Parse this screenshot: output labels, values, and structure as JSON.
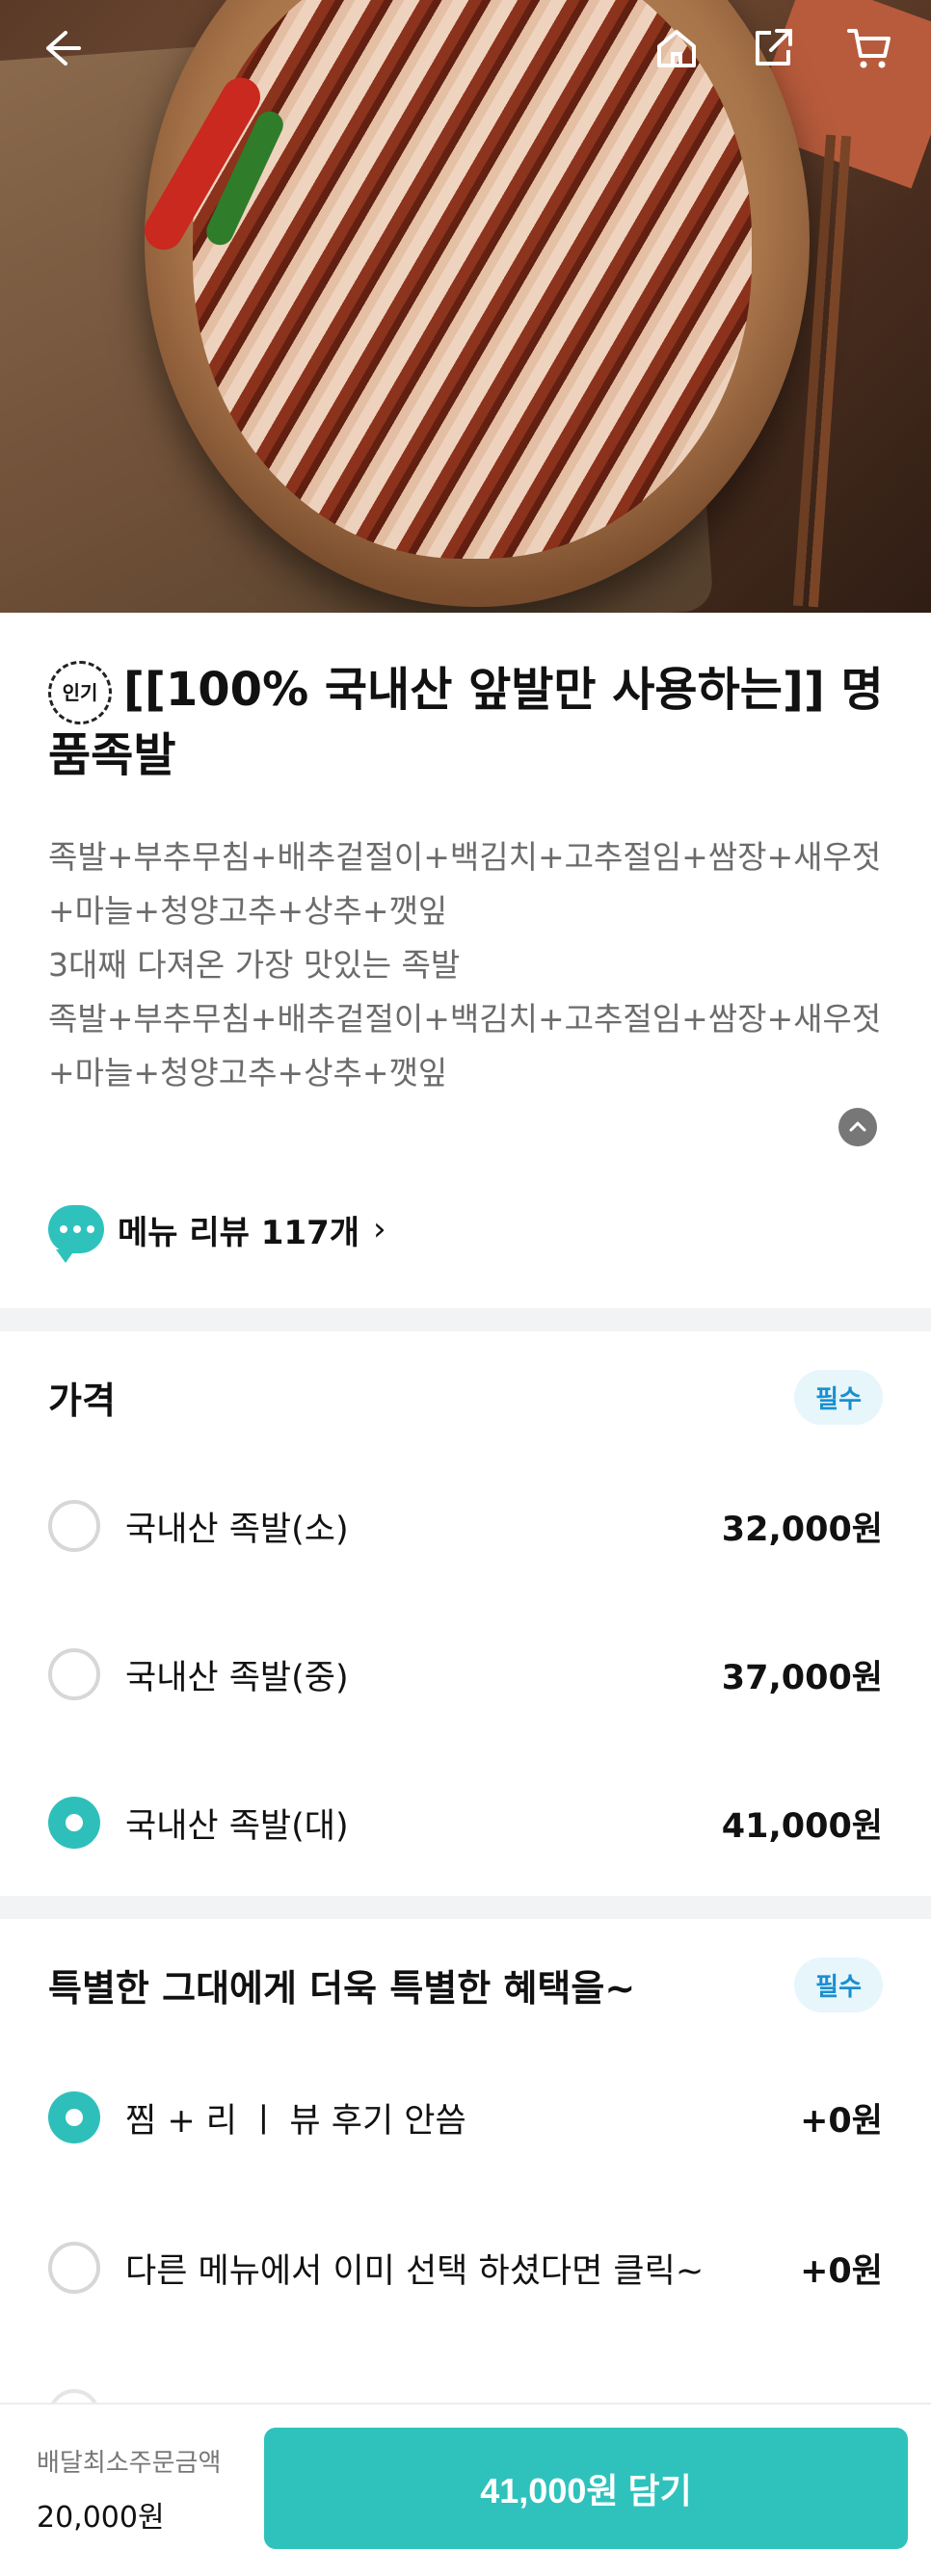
{
  "header": {
    "back_icon": "arrow-left-icon",
    "home_icon": "home-icon",
    "share_icon": "share-icon",
    "cart_icon": "cart-icon"
  },
  "product": {
    "badge": "인기",
    "title": "[[100% 국내산 앞발만 사용하는]] 명품족발",
    "description_lines": [
      "족발+부추무침+배추겉절이+백김치+고추절임+쌈장+새우젓+마늘+청양고추+상추+깻잎",
      "3대째 다져온 가장 맛있는 족발",
      "족발+부추무침+배추겉절이+백김치+고추절임+쌈장+새우젓+마늘+청양고추+상추+깻잎"
    ],
    "review_link": "메뉴 리뷰 117개",
    "review_chevron": "›"
  },
  "price_section": {
    "title": "가격",
    "required": "필수",
    "options": [
      {
        "label": "국내산 족발(소)",
        "price": "32,000원",
        "selected": false
      },
      {
        "label": "국내산 족발(중)",
        "price": "37,000원",
        "selected": false
      },
      {
        "label": "국내산 족발(대)",
        "price": "41,000원",
        "selected": true
      }
    ]
  },
  "benefit_section": {
    "title": "특별한 그대에게 더욱 특별한 혜택을~",
    "required": "필수",
    "options": [
      {
        "label": "찜 + 리 ㅣ 뷰 후기 안씀",
        "price": "+0원",
        "selected": true
      },
      {
        "label": "다른 메뉴에서 이미 선택 하셨다면 클릭~",
        "price": "+0원",
        "selected": false
      }
    ]
  },
  "bottom_bar": {
    "min_order_label": "배달최소주문금액",
    "min_order_value": "20,000원",
    "cart_button": "41,000원 담기"
  },
  "colors": {
    "accent": "#2fc2bd",
    "required_bg": "#e7f6fb",
    "required_text": "#1a8fd0"
  }
}
